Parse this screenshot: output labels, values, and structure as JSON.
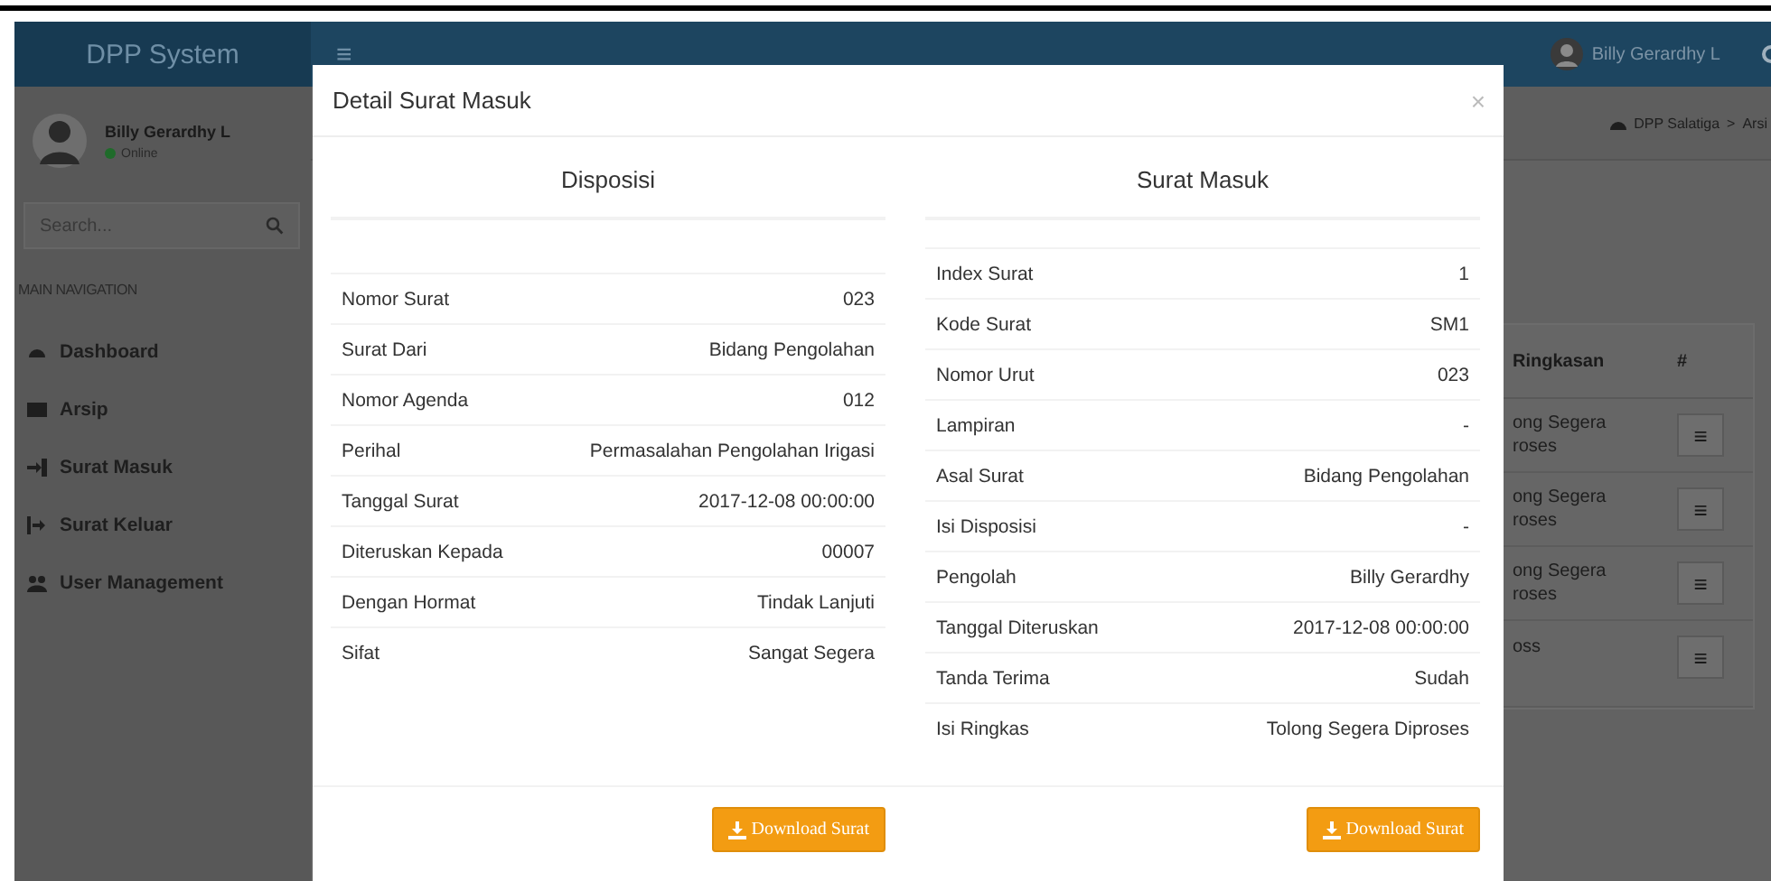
{
  "header": {
    "logo": "DPP System",
    "menu_glyph": "≡",
    "user_name": "Billy Gerardhy L"
  },
  "sidebar": {
    "user": {
      "name": "Billy Gerardhy L",
      "status": "Online"
    },
    "search": {
      "placeholder": "Search..."
    },
    "section_label": "MAIN NAVIGATION",
    "items": [
      {
        "label": "Dashboard"
      },
      {
        "label": "Arsip"
      },
      {
        "label": "Surat Masuk"
      },
      {
        "label": "Surat Keluar"
      },
      {
        "label": "User Management"
      }
    ]
  },
  "breadcrumb": {
    "items": [
      "DPP Salatiga",
      "Arsi"
    ],
    "separator": ">"
  },
  "table": {
    "columns": [
      "Ringkasan",
      "#"
    ],
    "rows": [
      {
        "ringkasan": [
          "ong Segera",
          "roses"
        ],
        "action": "≡"
      },
      {
        "ringkasan": [
          "ong Segera",
          "roses"
        ],
        "action": "≡"
      },
      {
        "ringkasan": [
          "ong Segera",
          "roses"
        ],
        "action": "≡"
      },
      {
        "ringkasan": [
          "oss"
        ],
        "action": "≡"
      }
    ]
  },
  "modal": {
    "title": "Detail Surat Masuk",
    "close": "×",
    "panels": [
      {
        "title": "Disposisi",
        "button": "Download Surat",
        "rows": [
          {
            "label": "Nomor Surat",
            "value": "023"
          },
          {
            "label": "Surat Dari",
            "value": "Bidang Pengolahan"
          },
          {
            "label": "Nomor Agenda",
            "value": "012"
          },
          {
            "label": "Perihal",
            "value": "Permasalahan Pengolahan Irigasi"
          },
          {
            "label": "Tanggal Surat",
            "value": "2017-12-08 00:00:00"
          },
          {
            "label": "Diteruskan Kepada",
            "value": "00007"
          },
          {
            "label": "Dengan Hormat",
            "value": "Tindak Lanjuti"
          },
          {
            "label": "Sifat",
            "value": "Sangat Segera"
          }
        ]
      },
      {
        "title": "Surat Masuk",
        "button": "Download Surat",
        "rows": [
          {
            "label": "Index Surat",
            "value": "1"
          },
          {
            "label": "Kode Surat",
            "value": "SM1"
          },
          {
            "label": "Nomor Urut",
            "value": "023"
          },
          {
            "label": "Lampiran",
            "value": "-"
          },
          {
            "label": "Asal Surat",
            "value": "Bidang Pengolahan"
          },
          {
            "label": "Isi Disposisi",
            "value": "-"
          },
          {
            "label": "Pengolah",
            "value": "Billy Gerardhy"
          },
          {
            "label": "Tanggal Diteruskan",
            "value": "2017-12-08 00:00:00"
          },
          {
            "label": "Tanda Terima",
            "value": "Sudah"
          },
          {
            "label": "Isi Ringkas",
            "value": "Tolong Segera Diproses"
          }
        ]
      }
    ]
  }
}
